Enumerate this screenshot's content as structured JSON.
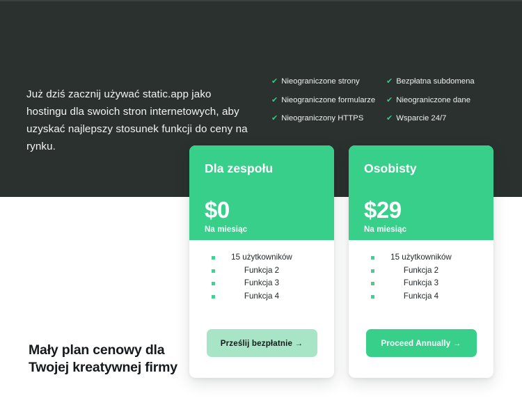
{
  "hero": {
    "intro": "Już dziś zacznij używać static.app jako hostingu dla swoich stron internetowych, aby uzyskać najlepszy stosunek funkcji do ceny na rynku.",
    "check_icon": "✔",
    "features_col1": [
      "Nieograniczone strony",
      "Nieograniczone formularze",
      "Nieograniczony HTTPS"
    ],
    "features_col2": [
      "Bezpłatna subdomena",
      "Nieograniczone dane",
      "Wsparcie 24/7"
    ]
  },
  "cards": [
    {
      "title": "Dla zespołu",
      "price": "$0",
      "period": "Na miesiąc",
      "features": [
        "15 użytkowników",
        "Funkcja 2",
        "Funkcja 3",
        "Funkcja 4"
      ],
      "cta": "Prześlij bezpłatnie →"
    },
    {
      "title": "Osobisty",
      "price": "$29",
      "period": "Na miesiąc",
      "features": [
        "15 użytkowników",
        "Funkcja 2",
        "Funkcja 3",
        "Funkcja 4"
      ],
      "cta": "Proceed Annually →"
    }
  ],
  "bottom": {
    "heading": "Mały plan cenowy dla Twojej kreatywnej firmy"
  },
  "colors": {
    "hero_bg": "#2a312e",
    "accent_green": "#38cf8b",
    "soft_green": "#a8e5c6",
    "check_green": "#33cc87",
    "bullet_green": "#46cf92",
    "page_bg": "#ffffff",
    "dark_text": "#15191b"
  }
}
